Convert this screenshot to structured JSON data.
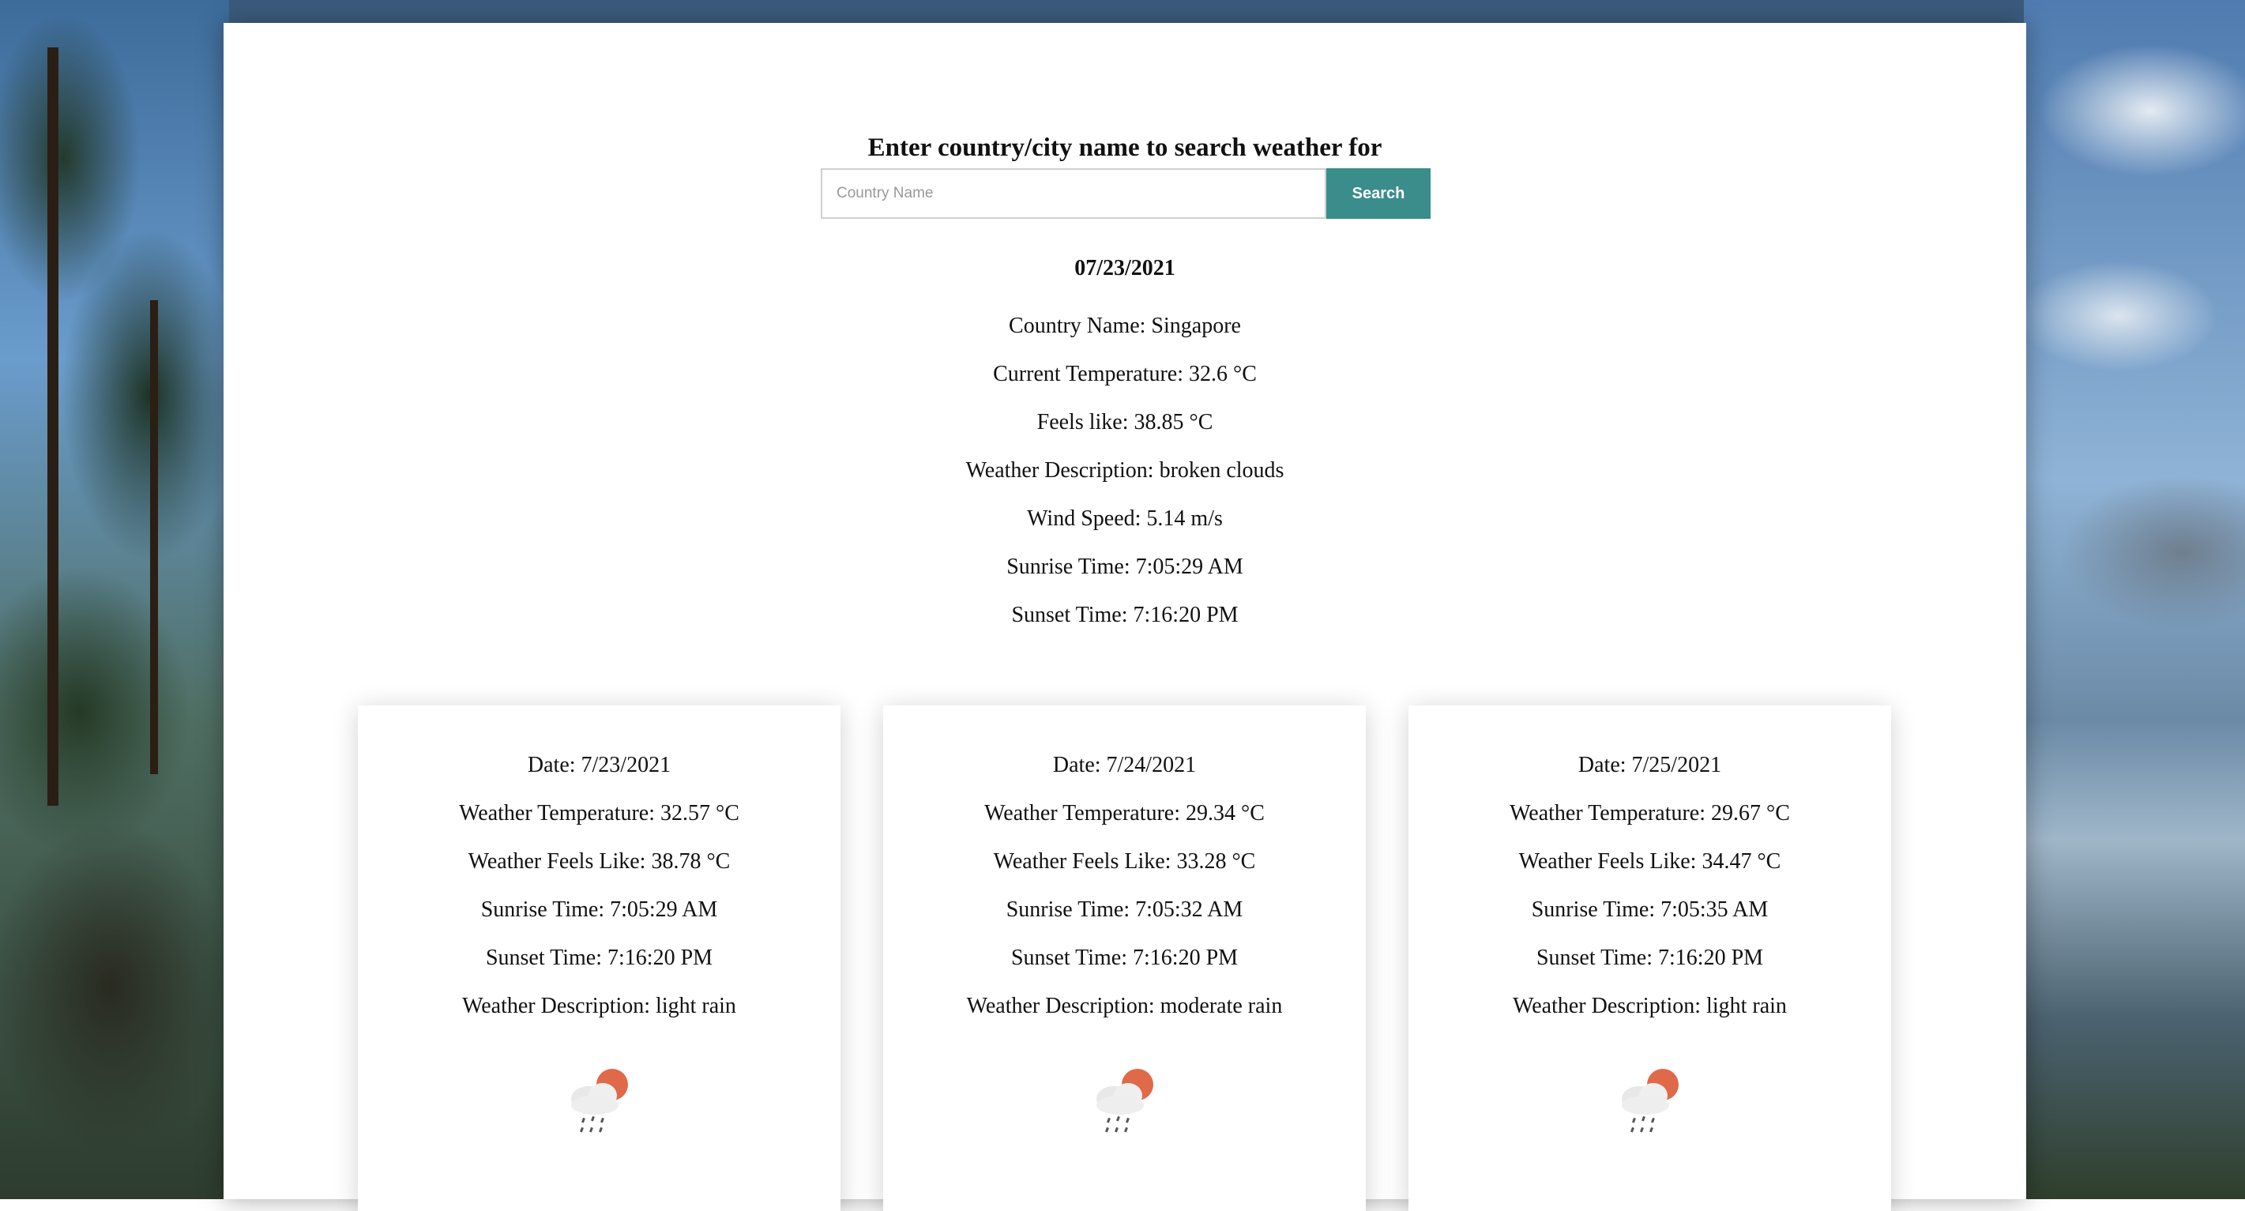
{
  "header": {
    "title": "Enter country/city name to search weather for"
  },
  "search": {
    "placeholder": "Country Name",
    "value": "",
    "button_label": "Search"
  },
  "current": {
    "date": "07/23/2021",
    "country": "Country Name: Singapore",
    "temperature": "Current Temperature: 32.6 °C",
    "feels_like": "Feels like: 38.85 °C",
    "description": "Weather Description: broken clouds",
    "wind_speed": "Wind Speed: 5.14 m/s",
    "sunrise": "Sunrise Time: 7:05:29 AM",
    "sunset": "Sunset Time: 7:16:20 PM"
  },
  "forecast": [
    {
      "date": "Date: 7/23/2021",
      "temperature": "Weather Temperature: 32.57 °C",
      "feels_like": "Weather Feels Like: 38.78 °C",
      "sunrise": "Sunrise Time: 7:05:29 AM",
      "sunset": "Sunset Time: 7:16:20 PM",
      "description": "Weather Description: light rain",
      "icon": "rain-sun-icon"
    },
    {
      "date": "Date: 7/24/2021",
      "temperature": "Weather Temperature: 29.34 °C",
      "feels_like": "Weather Feels Like: 33.28 °C",
      "sunrise": "Sunrise Time: 7:05:32 AM",
      "sunset": "Sunset Time: 7:16:20 PM",
      "description": "Weather Description: moderate rain",
      "icon": "rain-sun-icon"
    },
    {
      "date": "Date: 7/25/2021",
      "temperature": "Weather Temperature: 29.67 °C",
      "feels_like": "Weather Feels Like: 34.47 °C",
      "sunrise": "Sunrise Time: 7:05:35 AM",
      "sunset": "Sunset Time: 7:16:20 PM",
      "description": "Weather Description: light rain",
      "icon": "rain-sun-icon"
    }
  ],
  "colors": {
    "accent": "#3a8d8b",
    "sun": "#e0694a",
    "cloud": "#eeeeee"
  }
}
